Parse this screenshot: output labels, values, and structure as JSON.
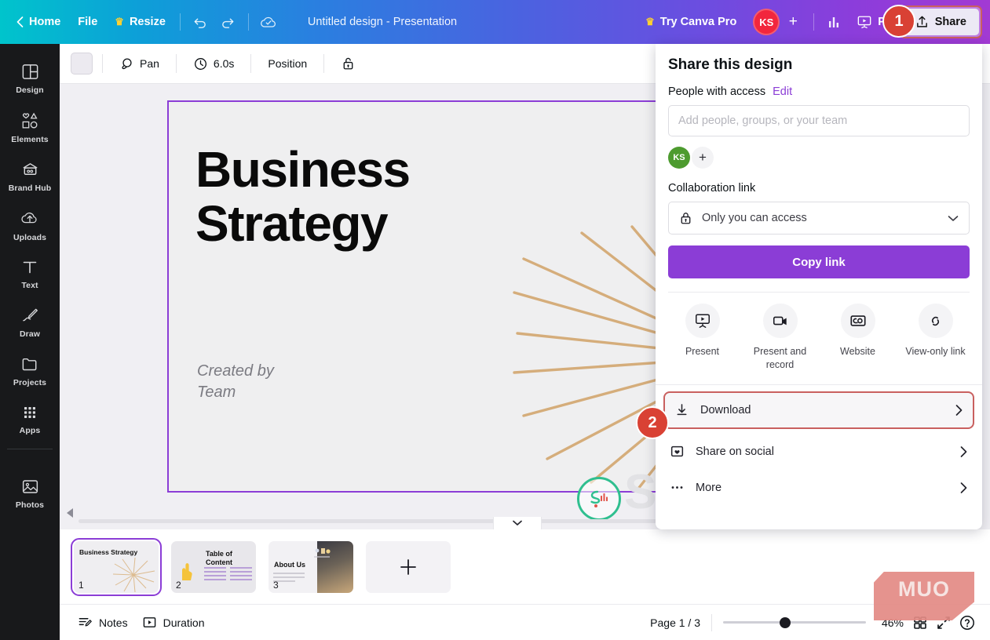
{
  "topbar": {
    "back_label": "Home",
    "file_label": "File",
    "resize_label": "Resize",
    "doc_title": "Untitled design - Presentation",
    "try_pro_label": "Try Canva Pro",
    "avatar_initials": "KS",
    "present_label": "Pre",
    "share_label": "Share",
    "badge_one": "1",
    "accent_purple": "#8b3dd6",
    "avatar_red": "#f2263d"
  },
  "sidebar": {
    "items": [
      {
        "label": "Design",
        "icon": "design-icon"
      },
      {
        "label": "Elements",
        "icon": "elements-icon"
      },
      {
        "label": "Brand Hub",
        "icon": "brand-hub-icon"
      },
      {
        "label": "Uploads",
        "icon": "uploads-icon"
      },
      {
        "label": "Text",
        "icon": "text-icon"
      },
      {
        "label": "Draw",
        "icon": "draw-icon"
      },
      {
        "label": "Projects",
        "icon": "projects-icon"
      },
      {
        "label": "Apps",
        "icon": "apps-icon"
      }
    ],
    "bottom_items": [
      {
        "label": "Photos",
        "icon": "photos-icon"
      }
    ]
  },
  "editor_toolbar": {
    "pan_label": "Pan",
    "duration_label": "6.0s",
    "position_label": "Position",
    "lock_icon": "unlock-icon"
  },
  "canvas": {
    "slide_title": "Business\nStrategy",
    "slide_title_line1": "Business",
    "slide_title_line2": "Strategy",
    "created_by_line1": "Created by",
    "created_by_line2": "Team",
    "watermark_text": "SI",
    "sunburst_color": "#d2a56b",
    "page_border_color": "#8b3dd6"
  },
  "share_panel": {
    "title": "Share this design",
    "people_with_access_label": "People with access",
    "edit_label": "Edit",
    "people_input_placeholder": "Add people, groups, or your team",
    "people_input_value": "",
    "avatar_initials": "KS",
    "add_person_label": "+",
    "collaboration_link_label": "Collaboration link",
    "access_value": "Only you can access",
    "copy_link_label": "Copy link",
    "quick_actions": [
      {
        "label": "Present",
        "icon": "present-icon"
      },
      {
        "label": "Present and record",
        "icon": "video-icon"
      },
      {
        "label": "Website",
        "icon": "website-icon"
      },
      {
        "label": "View-only link",
        "icon": "link-icon"
      }
    ],
    "menu_items": [
      {
        "label": "Download",
        "icon": "download-icon",
        "highlighted": true
      },
      {
        "label": "Share on social",
        "icon": "social-heart-icon",
        "highlighted": false
      },
      {
        "label": "More",
        "icon": "more-dots-icon",
        "highlighted": false
      }
    ],
    "badge_two": "2",
    "highlight_color": "#c9605f"
  },
  "page_strip": {
    "thumbs": [
      {
        "number": "1",
        "title": "Business Strategy",
        "selected": true
      },
      {
        "number": "2",
        "title": "Table of Content",
        "selected": false
      },
      {
        "number": "3",
        "title": "About Us",
        "selected": false
      }
    ],
    "add_page_label": "+"
  },
  "statusbar": {
    "notes_label": "Notes",
    "duration_label": "Duration",
    "page_indicator": "Page 1 / 3",
    "zoom_value": "46%",
    "grid_icon": "grid-view-icon",
    "fullscreen_icon": "fullscreen-icon",
    "help_icon": "help-icon"
  },
  "watermark": {
    "text": "MUO"
  }
}
